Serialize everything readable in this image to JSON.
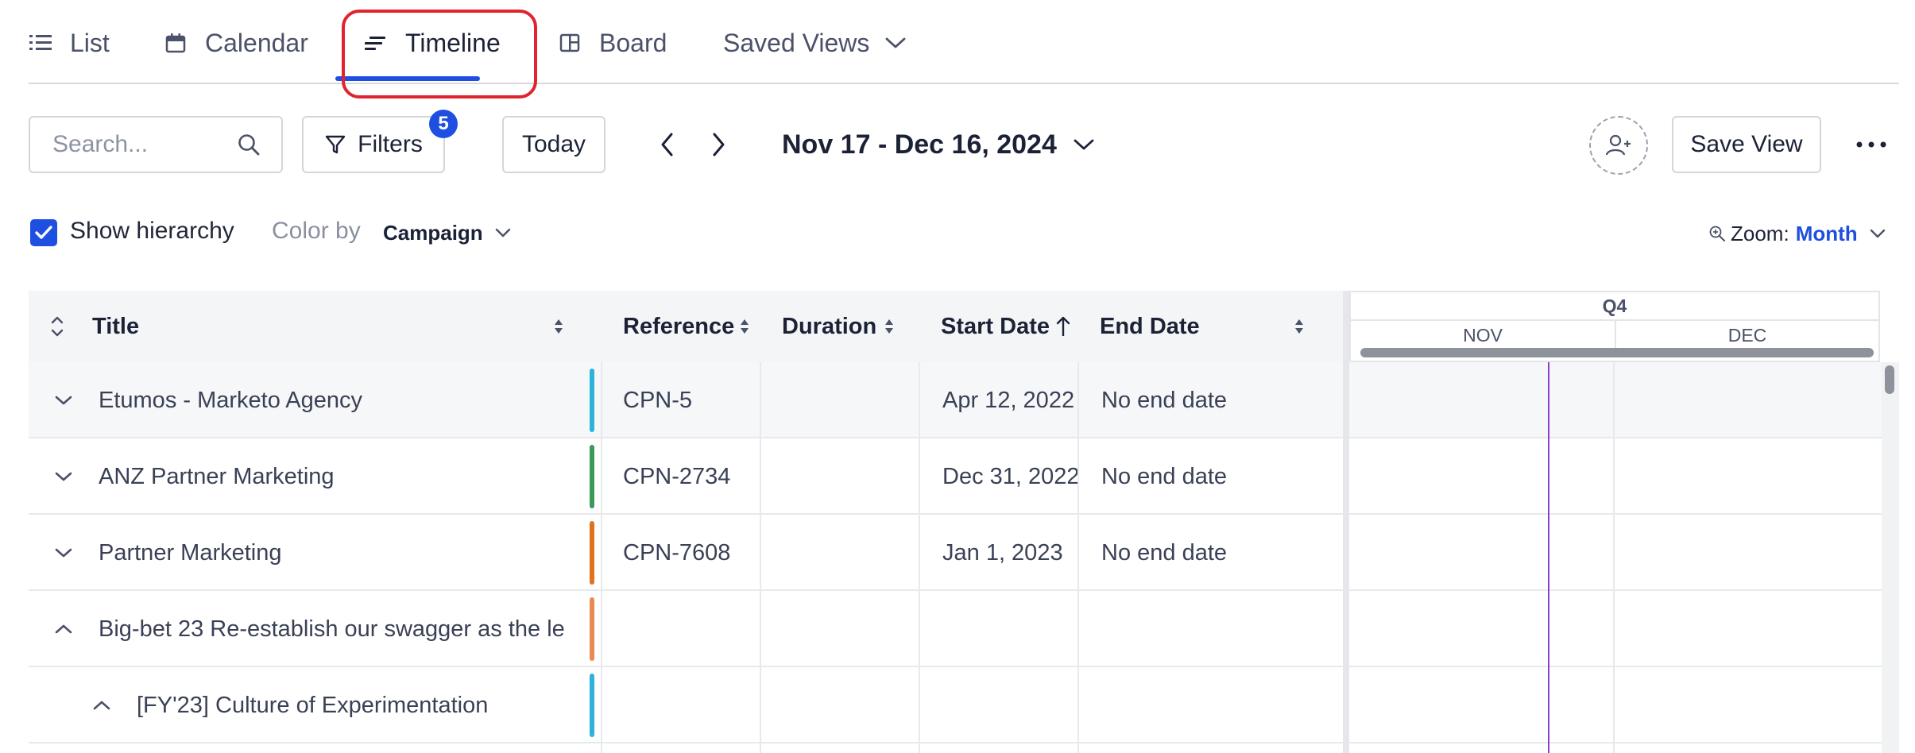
{
  "tabs": [
    {
      "label": "List",
      "icon": "list-icon"
    },
    {
      "label": "Calendar",
      "icon": "calendar-icon"
    },
    {
      "label": "Timeline",
      "icon": "timeline-icon",
      "active": true
    },
    {
      "label": "Board",
      "icon": "board-icon"
    },
    {
      "label": "Saved Views",
      "icon": "chevron-down-icon"
    }
  ],
  "toolbar": {
    "search_placeholder": "Search...",
    "filters_label": "Filters",
    "filters_count": "5",
    "today_label": "Today",
    "date_range": "Nov 17 - Dec 16, 2024",
    "save_view_label": "Save View"
  },
  "options": {
    "show_hierarchy_label": "Show hierarchy",
    "show_hierarchy_checked": true,
    "color_by_label": "Color by",
    "color_by_value": "Campaign",
    "zoom_label": "Zoom:",
    "zoom_value": "Month"
  },
  "table": {
    "columns": [
      "Title",
      "Reference",
      "Duration",
      "Start Date",
      "End Date"
    ],
    "rows": [
      {
        "title": "Etumos - Marketo Agency",
        "reference": "CPN-5",
        "duration": "",
        "start": "Apr 12, 2022",
        "end": "No end date",
        "color": "#2bb3d9",
        "expanded": false
      },
      {
        "title": "ANZ Partner Marketing",
        "reference": "CPN-2734",
        "duration": "",
        "start": "Dec 31, 2022",
        "end": "No end date",
        "color": "#3b9a5a",
        "expanded": false
      },
      {
        "title": "Partner Marketing",
        "reference": "CPN-7608",
        "duration": "",
        "start": "Jan 1, 2023",
        "end": "No end date",
        "color": "#e0721f",
        "expanded": false
      },
      {
        "title": "Big-bet 23 Re-establish our swagger as the le",
        "reference": "",
        "duration": "",
        "start": "",
        "end": "",
        "color": "#ea8a4e",
        "expanded": true
      },
      {
        "title": "[FY'23] Culture of Experimentation",
        "reference": "",
        "duration": "",
        "start": "",
        "end": "",
        "color": "#2bb3d9",
        "expanded": true
      }
    ]
  },
  "timeline": {
    "quarter": "Q4",
    "months": [
      "NOV",
      "DEC"
    ]
  },
  "colors": {
    "accent": "#1f4fe0",
    "highlight": "#e0232f",
    "today_line": "#8b3fd1"
  }
}
